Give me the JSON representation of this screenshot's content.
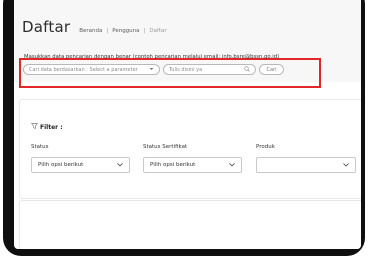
{
  "header": {
    "title": "Daftar",
    "breadcrumb": [
      "Beranda",
      "Pengguna",
      "Daftar"
    ],
    "separator": "|"
  },
  "search": {
    "help_text": "Masukkan data pencarian dengan benar (contoh pencarian melalui email: info.bsre@bssn.go.id)",
    "param_placeholder": "Cari data berdasarkan : Select a parameter",
    "input_placeholder": "Tulis disini ya",
    "button_label": "Cari"
  },
  "filter": {
    "title": "Filter :",
    "fields": [
      {
        "label": "Status",
        "value": "Pilih opsi berikut"
      },
      {
        "label": "Status Sertifikat",
        "value": "Pilih opsi berikut"
      },
      {
        "label": "Produk",
        "value": ""
      }
    ]
  },
  "colors": {
    "highlight": "#e2262a",
    "device_frame": "#0f0f10"
  },
  "icons": [
    "filter-icon",
    "search-icon",
    "chevron-down-icon"
  ]
}
